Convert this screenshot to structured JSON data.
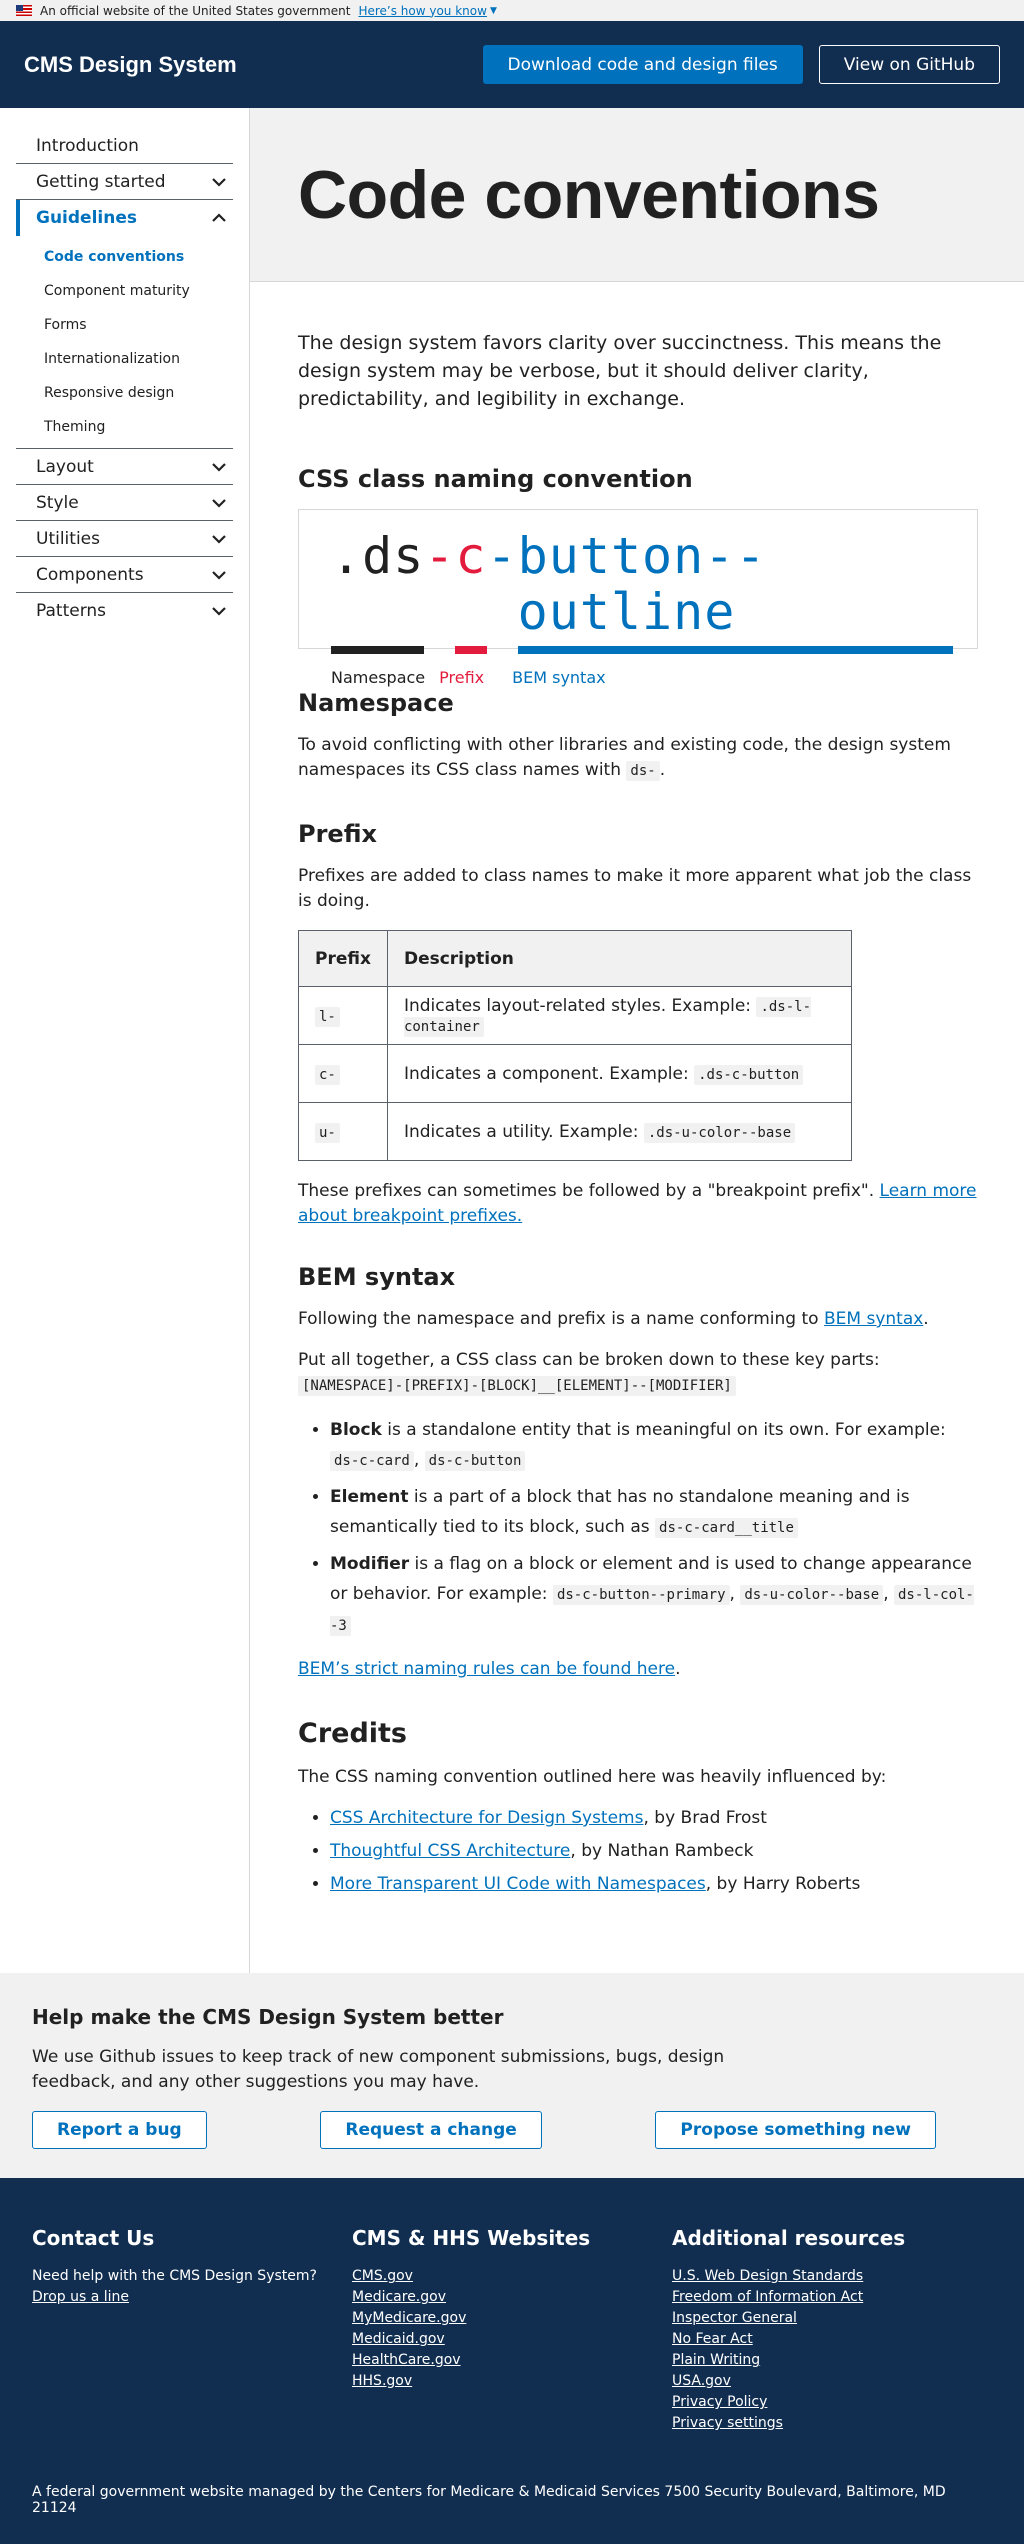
{
  "banner": {
    "text": "An official website of the United States government",
    "link": "Here’s how you know"
  },
  "header": {
    "title": "CMS Design System",
    "download_label": "Download code and design files",
    "github_label": "View on GitHub"
  },
  "sidebar": {
    "items": [
      {
        "label": "Introduction"
      },
      {
        "label": "Getting started"
      },
      {
        "label": "Guidelines"
      },
      {
        "label": "Layout"
      },
      {
        "label": "Style"
      },
      {
        "label": "Utilities"
      },
      {
        "label": "Components"
      },
      {
        "label": "Patterns"
      }
    ],
    "sub_items": [
      {
        "label": "Code conventions"
      },
      {
        "label": "Component maturity"
      },
      {
        "label": "Forms"
      },
      {
        "label": "Internationalization"
      },
      {
        "label": "Responsive design"
      },
      {
        "label": "Theming"
      }
    ]
  },
  "page": {
    "title": "Code conventions",
    "lead": "The design system favors clarity over succinctness. This means the design system may be verbose, but it should deliver clarity, predictability, and legibility in exchange.",
    "naming": {
      "heading": "CSS class naming convention",
      "ns": ".ds",
      "dash": "-",
      "prefix": "c",
      "dash2": "-",
      "bem": "button--outline",
      "label_ns": "Namespace",
      "label_px": "Prefix",
      "label_bem": "BEM syntax"
    },
    "namespace": {
      "heading": "Namespace",
      "text": "To avoid conflicting with other libraries and existing code, the design system namespaces its CSS class names with",
      "code": "ds-",
      "end": "."
    },
    "prefix": {
      "heading": "Prefix",
      "text": "Prefixes are added to class names to make it more apparent what job the class is doing.",
      "col_prefix": "Prefix",
      "col_desc": "Description",
      "rows": [
        {
          "prefix": "l-",
          "desc": "Indicates layout-related styles. Example:",
          "example": ".ds-l-container"
        },
        {
          "prefix": "c-",
          "desc": "Indicates a component. Example:",
          "example": ".ds-c-button"
        },
        {
          "prefix": "u-",
          "desc": "Indicates a utility. Example:",
          "example": ".ds-u-color--base"
        }
      ],
      "note": "These prefixes can sometimes be followed by a \"breakpoint prefix\".",
      "note_link": "Learn more about breakpoint prefixes."
    },
    "bem": {
      "heading": "BEM syntax",
      "intro": "Following the namespace and prefix is a name conforming to",
      "intro_link": "BEM syntax",
      "intro_end": ".",
      "together": "Put all together, a CSS class can be broken down to these key parts:",
      "pattern": "[NAMESPACE]-[PREFIX]-[BLOCK]__[ELEMENT]--[MODIFIER]",
      "block_term": "Block",
      "block_text": "is a standalone entity that is meaningful on its own. For example:",
      "block_ex1": "ds-c-card",
      "block_ex2": "ds-c-button",
      "elem_term": "Element",
      "elem_text": "is a part of a block that has no standalone meaning and is semantically tied to its block, such as",
      "elem_ex": "ds-c-card__title",
      "mod_term": "Modifier",
      "mod_text": "is a flag on a block or element and is used to change appearance or behavior. For example:",
      "mod_ex1": "ds-c-button--primary",
      "mod_ex2": "ds-u-color--base",
      "mod_ex3": "ds-l-col--3",
      "strict_link": "BEM’s strict naming rules can be found here",
      "strict_end": "."
    },
    "credits": {
      "heading": "Credits",
      "text": "The CSS naming convention outlined here was heavily influenced by:",
      "items": [
        {
          "link": "CSS Architecture for Design Systems",
          "by": ", by Brad Frost"
        },
        {
          "link": "Thoughtful CSS Architecture",
          "by": ", by Nathan Rambeck"
        },
        {
          "link": "More Transparent UI Code with Namespaces",
          "by": ", by Harry Roberts"
        }
      ]
    }
  },
  "help": {
    "heading": "Help make the CMS Design System better",
    "text": "We use Github issues to keep track of new component submissions, bugs, design feedback, and any other suggestions you may have.",
    "bug": "Report a bug",
    "change": "Request a change",
    "propose": "Propose something new"
  },
  "footer": {
    "contact_heading": "Contact Us",
    "contact_text": "Need help with the CMS Design System?",
    "contact_link": "Drop us a line",
    "sites_heading": "CMS & HHS Websites",
    "sites": [
      "CMS.gov",
      "Medicare.gov",
      "MyMedicare.gov",
      "Medicaid.gov",
      "HealthCare.gov",
      "HHS.gov"
    ],
    "resources_heading": "Additional resources",
    "resources": [
      "U.S. Web Design Standards",
      "Freedom of Information Act",
      "Inspector General",
      "No Fear Act",
      "Plain Writing",
      "USA.gov",
      "Privacy Policy",
      "Privacy settings"
    ],
    "bottom": "A federal government website managed by the Centers for Medicare & Medicaid Services 7500 Security Boulevard, Baltimore, MD 21124"
  }
}
